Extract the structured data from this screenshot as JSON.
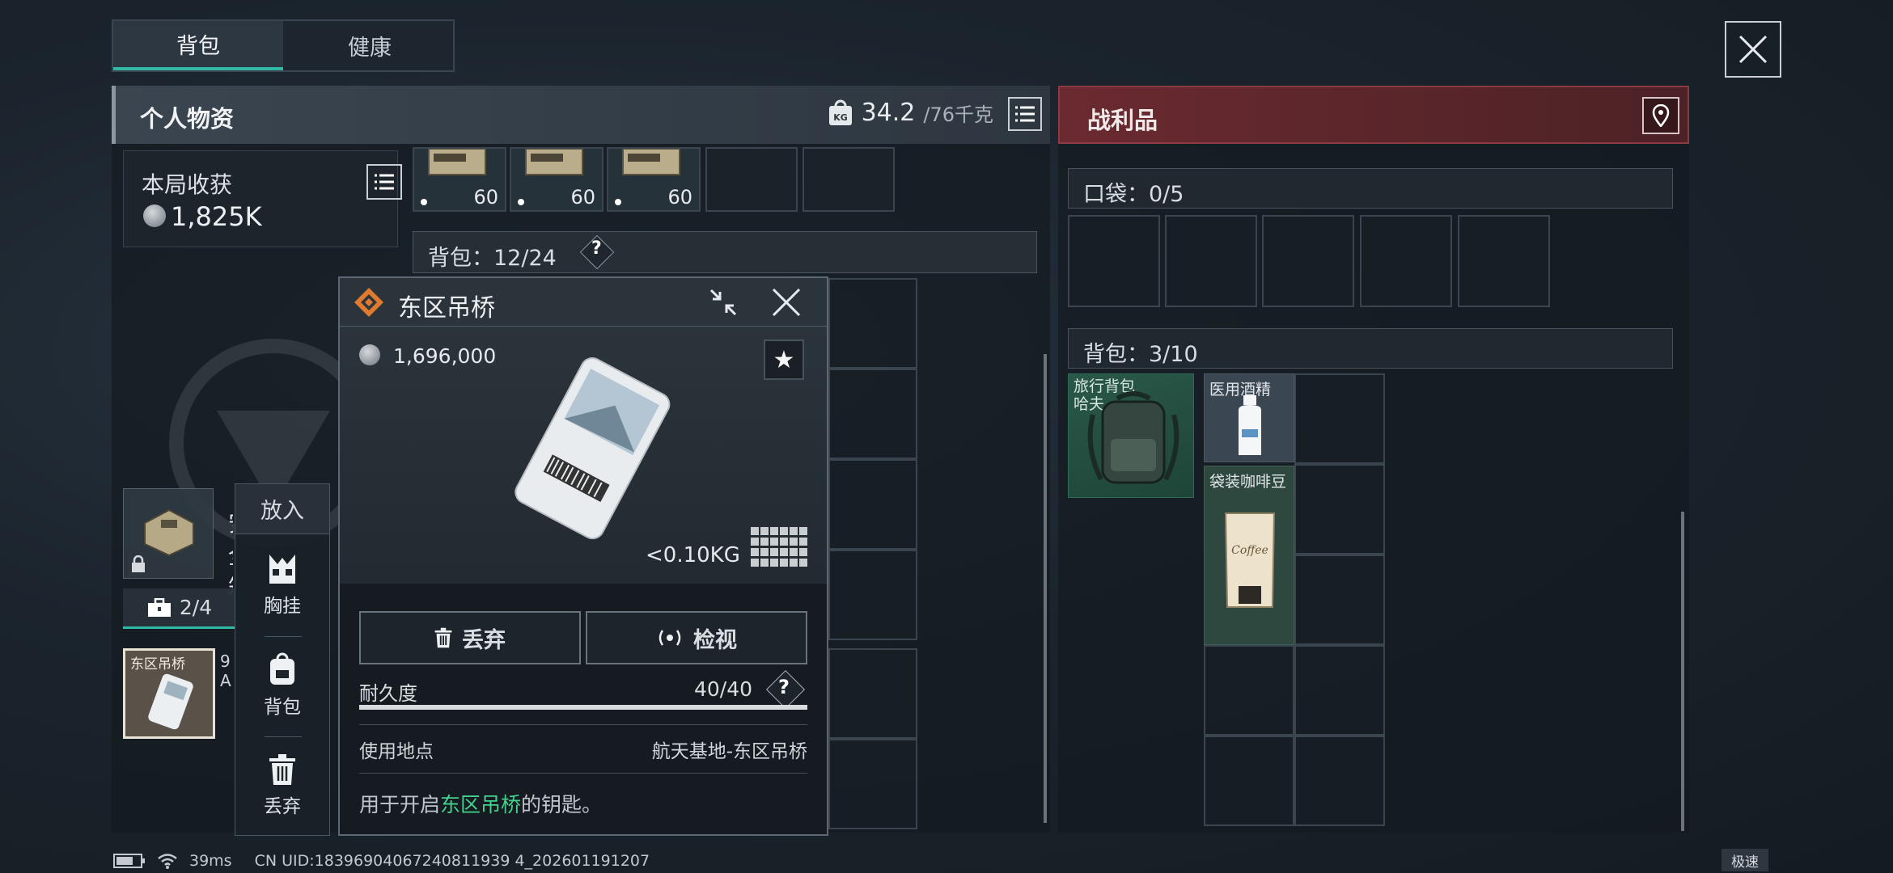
{
  "tabs": {
    "backpack": "背包",
    "health": "健康"
  },
  "personal": {
    "title": "个人物资",
    "weight_current": "34.2",
    "weight_max": "/76千克"
  },
  "harvest": {
    "label": "本局收获",
    "value": "1,825K"
  },
  "pouch_counts": [
    "60",
    "60",
    "60"
  ],
  "left_backpack": {
    "label": "背包：12/24",
    "help": "?"
  },
  "safe_box": {
    "label": "安全箱"
  },
  "chest": {
    "count": "2/4"
  },
  "key_slot": {
    "label": "东区吊桥"
  },
  "side_text": {
    "line1": "9",
    "line2": "A"
  },
  "putin_menu": {
    "title": "放入",
    "items": [
      {
        "label": "胸挂",
        "icon": "vest-icon"
      },
      {
        "label": "背包",
        "icon": "backpack-icon"
      },
      {
        "label": "丢弃",
        "icon": "trash-icon"
      }
    ]
  },
  "popup": {
    "title": "东区吊桥",
    "price": "1,696,000",
    "weight": "<0.10KG",
    "discard_label": "丢弃",
    "inspect_label": "检视",
    "durability_label": "耐久度",
    "durability_value": "40/40",
    "durability_fraction": 1.0,
    "use_label": "使用地点",
    "use_value": "航天基地-东区吊桥",
    "desc_prefix": "用于开启",
    "desc_highlight": "东区吊桥",
    "desc_suffix": "的钥匙。"
  },
  "loot": {
    "title": "战利品",
    "pocket_label": "口袋：0/5",
    "backpack_label": "背包：3/10",
    "travel_bag_label": "旅行背包 哈夫",
    "alcohol_label": "医用酒精",
    "coffee_label": "袋装咖啡豆"
  },
  "status": {
    "ping": "39ms",
    "uid": "CN UID:18396904067240811939 4_202601191207",
    "speed": "极速"
  },
  "colors": {
    "accent_teal": "#2fb8a6",
    "loot_red": "#6a2a30",
    "highlight_green": "#43d18e",
    "key_icon_orange": "#e07a2e"
  }
}
